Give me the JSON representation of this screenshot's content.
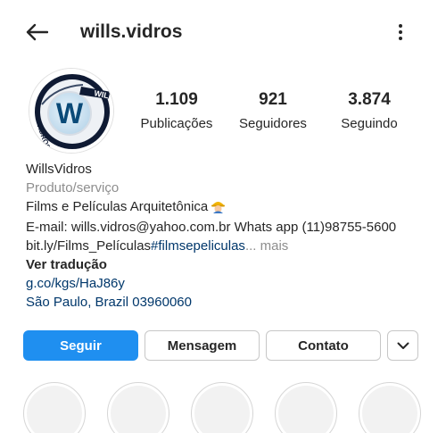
{
  "header": {
    "back_icon": "arrow-left-icon",
    "username": "wills.vidros",
    "more_icon": "more-vertical-icon"
  },
  "avatar": {
    "logo_text": "WILLS VIDROS",
    "logo_letter": "W"
  },
  "stats": [
    {
      "value": "1.109",
      "label": "Publicações"
    },
    {
      "value": "921",
      "label": "Seguidores"
    },
    {
      "value": "3.874",
      "label": "Seguindo"
    }
  ],
  "bio": {
    "name": "WillsVidros",
    "category": "Produto/serviço",
    "line1": "Films e Películas Arquitetônica",
    "line1_emoji": "construction-worker-emoji",
    "line2": "E-mail: wills.vidros@yahoo.com.br Whats app (11)98755-5600",
    "line3_text": "bit.ly/Films_Películas",
    "line3_hashtag": "#filmsepeliculas",
    "line3_more": "... mais",
    "translate": "Ver tradução",
    "link": "g.co/kgs/HaJ86y",
    "location": "São Paulo, Brazil 03960060"
  },
  "buttons": {
    "follow": "Seguir",
    "message": "Mensagem",
    "contact": "Contato",
    "chevron_icon": "chevron-down-icon"
  },
  "colors": {
    "primary_button": "#1f8ff0",
    "link": "#00376b",
    "secondary_text": "#8e8e8e"
  }
}
